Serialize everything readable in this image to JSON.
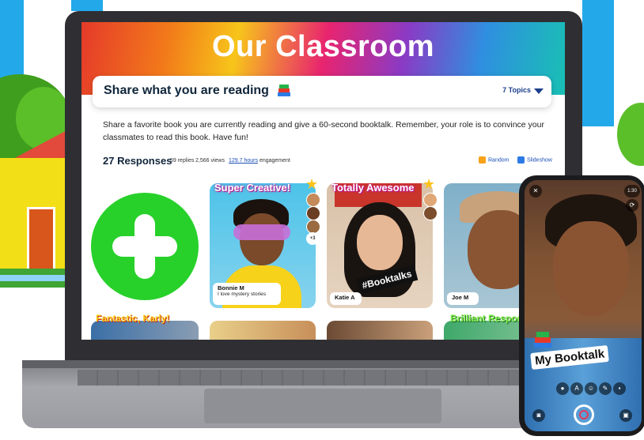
{
  "screen": {
    "banner_title": "Our Classroom",
    "topic_title": "Share what you are reading",
    "topics_link": "7 Topics",
    "description": "Share a favorite book you are currently reading and give a 60-second booktalk. Remember, your role is to convince your classmates to read this book. Have fun!",
    "responses_count": "27 Responses",
    "replies": "59 replies",
    "views": "2,566 views",
    "engagement_hours": "129.7 hours",
    "engagement_label": "engagement",
    "random_label": "Random",
    "slideshow_label": "Slideshow"
  },
  "cards": [
    {
      "tag": "Super Creative!",
      "name": "Bonnie M",
      "subtitle": "I love mystery stories",
      "extra_count": "+3"
    },
    {
      "tag": "Totally Awesome",
      "name": "Katie A",
      "hashtag": "#Booktalks"
    },
    {
      "tag": "",
      "name": "Joe M"
    }
  ],
  "bottom_tags": [
    "Fantastic, Karly!",
    "Brilliant Response"
  ],
  "phone": {
    "sticker_text": "My Booktalk",
    "timer": "1:30"
  },
  "colors": {
    "add_button": "#27d12a",
    "link_blue": "#1a4fb5",
    "title_navy": "#10263b"
  }
}
